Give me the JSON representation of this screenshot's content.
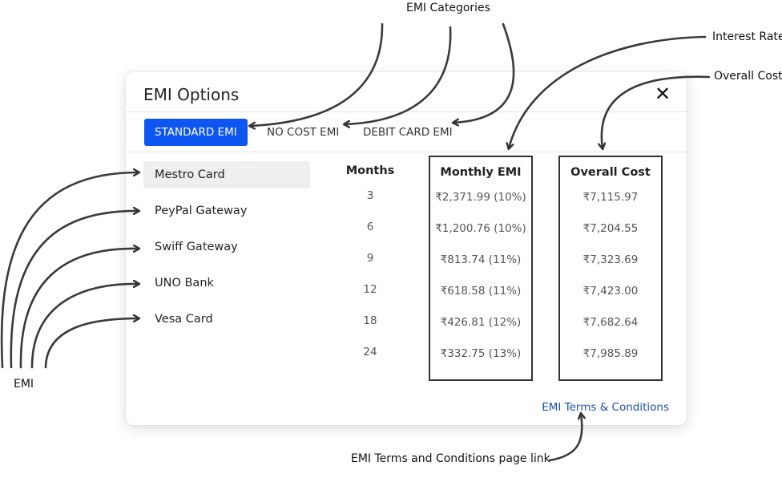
{
  "annotations": {
    "emi_categories": "EMI Categories",
    "interest_rate": "Interest Rate",
    "overall_cost": "Overall Cost",
    "emi": "EMI",
    "terms_page_link": "EMI Terms and Conditions page link"
  },
  "modal": {
    "title": "EMI Options",
    "close_icon": "close-icon",
    "tabs": [
      {
        "label": "STANDARD EMI",
        "active": true
      },
      {
        "label": "NO COST EMI",
        "active": false
      },
      {
        "label": "DEBIT CARD EMI",
        "active": false
      }
    ],
    "providers": [
      {
        "label": "Mestro Card",
        "selected": true
      },
      {
        "label": "PeyPal Gateway",
        "selected": false
      },
      {
        "label": "Swiff Gateway",
        "selected": false
      },
      {
        "label": "UNO Bank",
        "selected": false
      },
      {
        "label": "Vesa Card",
        "selected": false
      }
    ],
    "table": {
      "headers": [
        "Months",
        "Monthly EMI",
        "Overall Cost"
      ],
      "rows": [
        {
          "months": "3",
          "monthly": "₹2,371.99 (10%)",
          "overall": "₹7,115.97"
        },
        {
          "months": "6",
          "monthly": "₹1,200.76 (10%)",
          "overall": "₹7,204.55"
        },
        {
          "months": "9",
          "monthly": "₹813.74 (11%)",
          "overall": "₹7,323.69"
        },
        {
          "months": "12",
          "monthly": "₹618.58 (11%)",
          "overall": "₹7,423.00"
        },
        {
          "months": "18",
          "monthly": "₹426.81 (12%)",
          "overall": "₹7,682.64"
        },
        {
          "months": "24",
          "monthly": "₹332.75 (13%)",
          "overall": "₹7,985.89"
        }
      ]
    },
    "terms_link": "EMI Terms & Conditions",
    "colors": {
      "accent": "#0d56f2",
      "link": "#1d4fa8",
      "selected_bg": "#efefef"
    }
  }
}
